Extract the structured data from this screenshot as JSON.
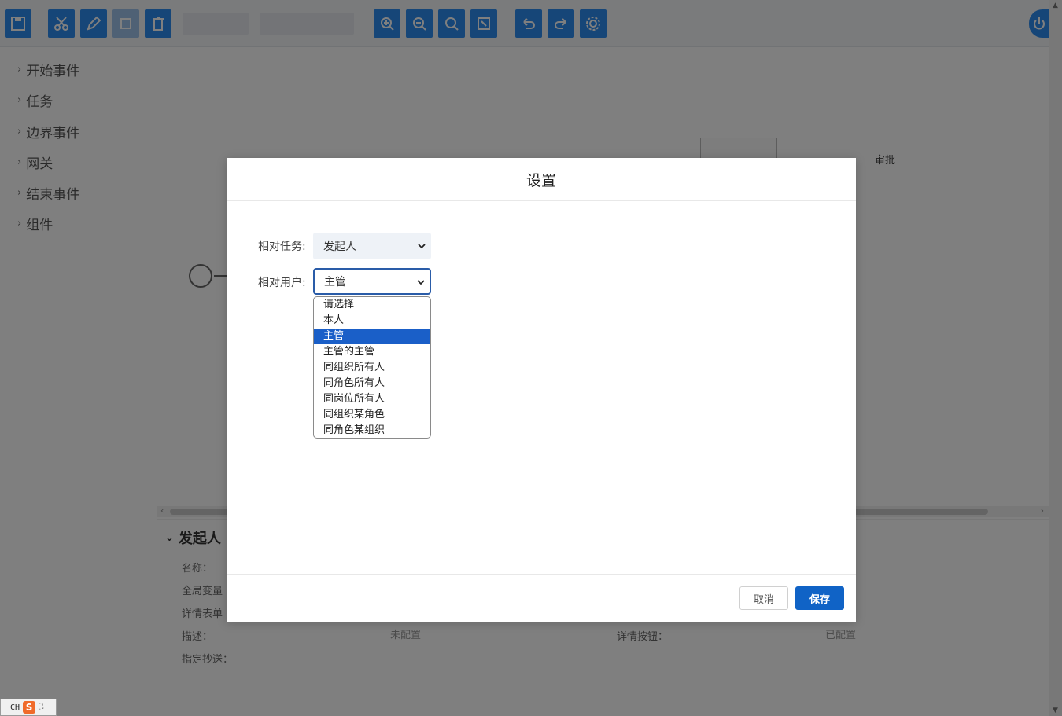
{
  "palette": {
    "items": [
      {
        "label": "开始事件"
      },
      {
        "label": "任务"
      },
      {
        "label": "边界事件"
      },
      {
        "label": "网关"
      },
      {
        "label": "结束事件"
      },
      {
        "label": "组件"
      }
    ]
  },
  "canvas": {
    "task_label": "审批"
  },
  "properties": {
    "title": "发起人",
    "name_label": "名称：",
    "global_var_label": "全局变量",
    "detail_form_label": "详情表单",
    "desc_label": "描述：",
    "desc_value": "未配置",
    "detail_button_label": "详情按钮：",
    "detail_button_value": "已配置",
    "cc_label": "指定抄送："
  },
  "modal": {
    "title": "设置",
    "relative_task_label": "相对任务:",
    "relative_task_value": "发起人",
    "relative_user_label": "相对用户:",
    "relative_user_value": "主管",
    "options": [
      "请选择",
      "本人",
      "主管",
      "主管的主管",
      "同组织所有人",
      "同角色所有人",
      "同岗位所有人",
      "同组织某角色",
      "同角色某组织"
    ],
    "selected_option": "主管",
    "cancel_label": "取消",
    "save_label": "保存"
  },
  "ime": {
    "lang": "CH",
    "logo": "S"
  },
  "colors": {
    "primary": "#1063c6",
    "selected_option": "#1a5fc8",
    "toolbar_icon": "#2d8cf0",
    "overlay": "rgba(0,0,0,0.5)"
  },
  "icons": [
    "save-icon",
    "cut-icon",
    "edit-icon",
    "delete-icon",
    "zoom-in-icon",
    "zoom-out-icon",
    "zoom-reset-icon",
    "fit-icon",
    "undo-icon",
    "redo-icon",
    "gear-icon",
    "power-icon",
    "chevron-right-icon",
    "chevron-down-icon"
  ]
}
